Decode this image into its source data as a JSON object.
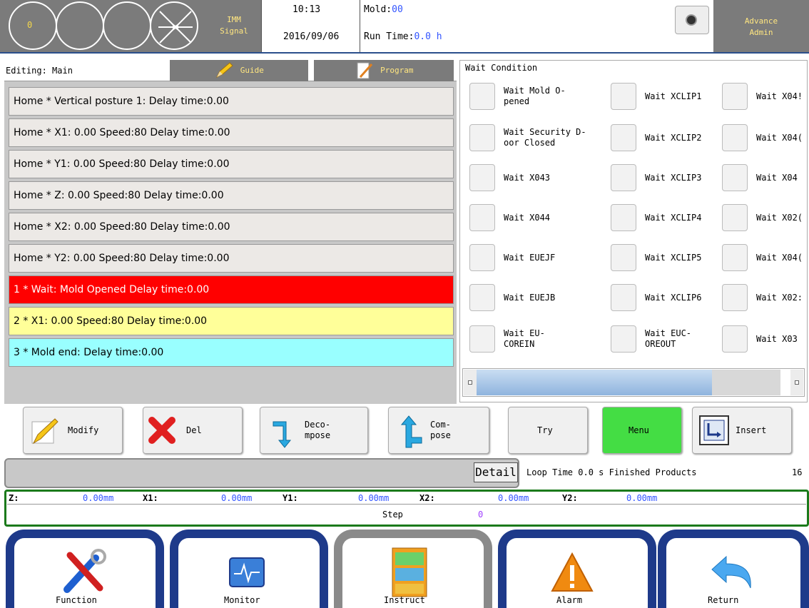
{
  "header": {
    "counter": "0",
    "imm_line1": "IMM",
    "imm_line2": "Signal",
    "time": "10:13",
    "date": "2016/09/06",
    "mold_label": "Mold:",
    "mold_value": "00",
    "run_label": "Run Time:",
    "run_value": "0.0 h",
    "user_role": "Advance",
    "user_name": "Admin",
    "colors": {
      "panel": "#7b7b7b",
      "accent": "#ffe680",
      "border": "#2b4f8c"
    }
  },
  "editor": {
    "editing": "Editing: Main",
    "tab_guide": "Guide",
    "tab_program": "Program"
  },
  "program_rows": [
    {
      "text": "Home    *    Vertical posture 1:  Delay time:0.00",
      "color": "#ece9e6"
    },
    {
      "text": "Home    *    X1: 0.00 Speed:80  Delay time:0.00",
      "color": "#ece9e6"
    },
    {
      "text": "Home    *    Y1: 0.00 Speed:80  Delay time:0.00",
      "color": "#ece9e6"
    },
    {
      "text": "Home    *    Z: 0.00 Speed:80  Delay time:0.00",
      "color": "#ece9e6"
    },
    {
      "text": "Home    *    X2: 0.00 Speed:80  Delay time:0.00",
      "color": "#ece9e6"
    },
    {
      "text": "Home    *    Y2: 0.00 Speed:80  Delay time:0.00",
      "color": "#ece9e6"
    },
    {
      "text": "1    *    Wait: Mold Opened Delay time:0.00",
      "color": "#ff0000"
    },
    {
      "text": "2    *    X1: 0.00 Speed:80  Delay time:0.00",
      "color": "#ffff99"
    },
    {
      "text": "3    *    Mold end:  Delay time:0.00",
      "color": "#99ffff"
    }
  ],
  "wait_panel": {
    "title": "Wait Condition",
    "col1": [
      "Wait Mold O-\npened",
      "Wait Security D-\noor Closed",
      "Wait X043",
      "Wait X044",
      "Wait EUEJF",
      "Wait EUEJB",
      "Wait EU-\nCOREIN"
    ],
    "col2": [
      "Wait XCLIP1",
      "Wait XCLIP2",
      "Wait XCLIP3",
      "Wait XCLIP4",
      "Wait XCLIP5",
      "Wait XCLIP6",
      "Wait EUC-\nOREOUT"
    ],
    "col3": [
      "Wait X04!",
      "Wait X04(",
      "Wait X04",
      "Wait X02(",
      "Wait X04(",
      "Wait X02:",
      "Wait X03"
    ]
  },
  "actions": {
    "modify": "Modify",
    "del": "Del",
    "decompose": "Deco-\nmpose",
    "compose": "Com-\npose",
    "try": "Try",
    "menu": "Menu",
    "insert": "Insert",
    "menu_color": "#44dd44"
  },
  "status": {
    "detail": "Detail",
    "loop": "Loop Time   0.0 s Finished Products",
    "finished": "16"
  },
  "axes": {
    "z_lbl": "Z:",
    "z_val": "0.00mm",
    "x1_lbl": "X1:",
    "x1_val": "0.00mm",
    "y1_lbl": "Y1:",
    "y1_val": "0.00mm",
    "x2_lbl": "X2:",
    "x2_val": "0.00mm",
    "y2_lbl": "Y2:",
    "y2_val": "0.00mm",
    "step_lbl": "Step",
    "step_val": "0"
  },
  "nav": {
    "function": "Function",
    "monitor": "Monitor",
    "instruct": "Instruct",
    "alarm": "Alarm",
    "return": "Return",
    "active": "Instruct"
  }
}
